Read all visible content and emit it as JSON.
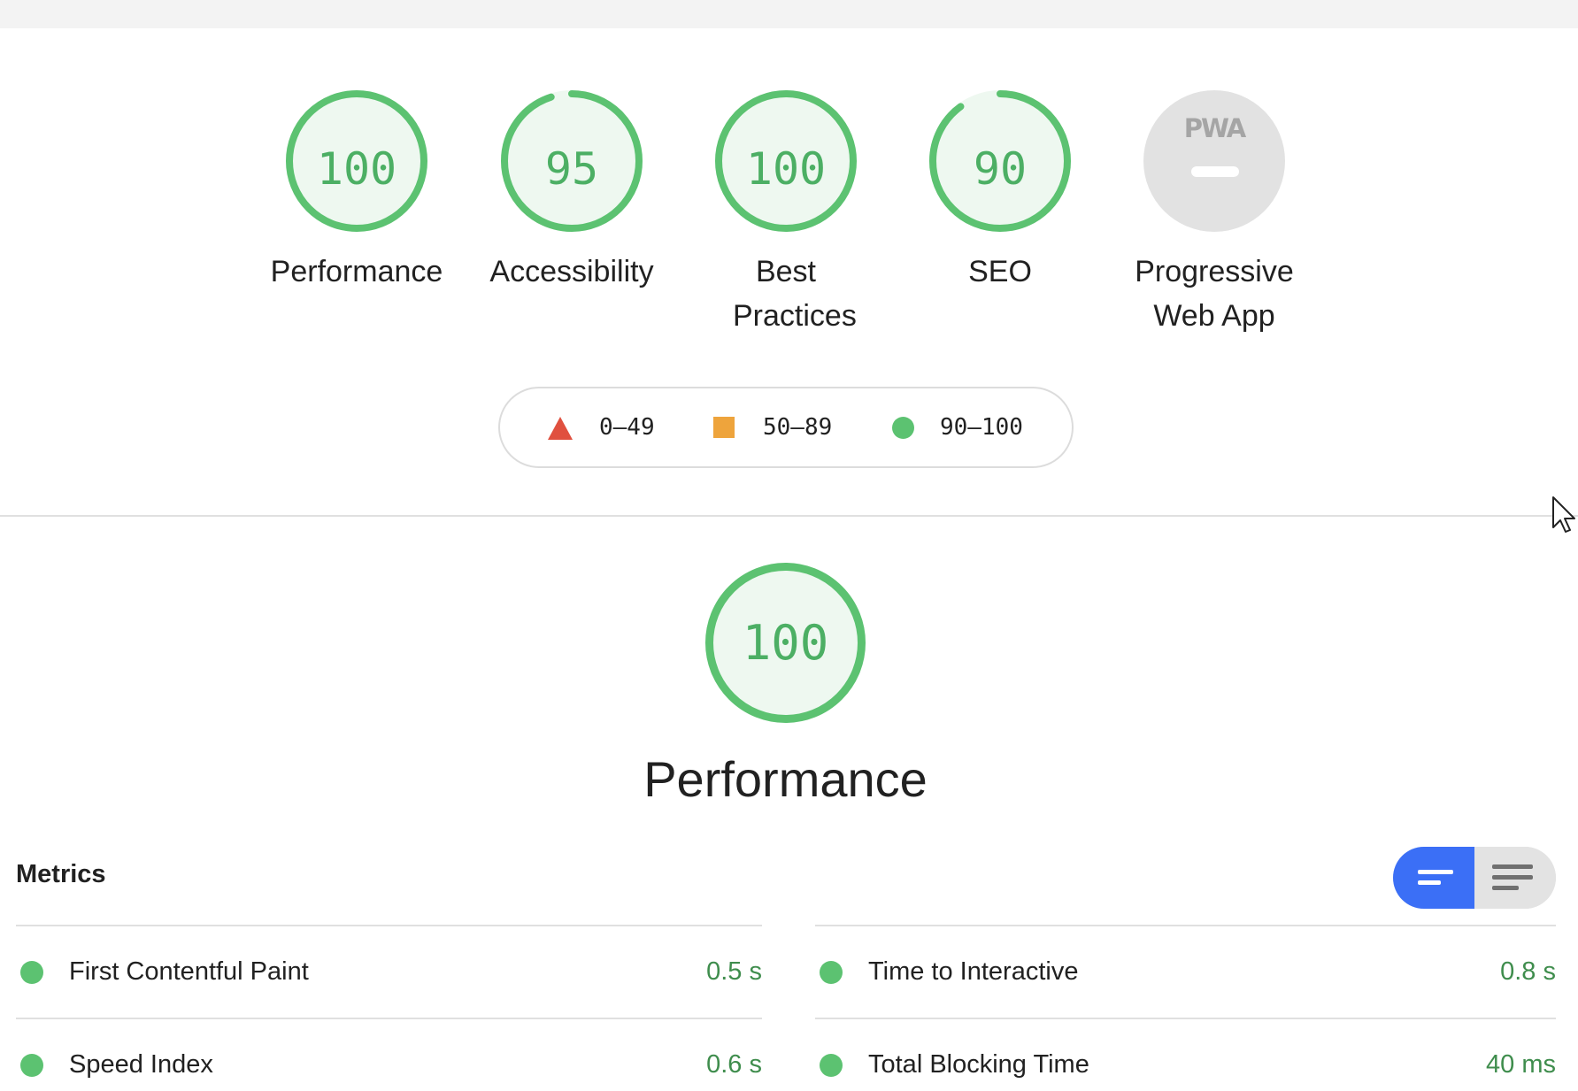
{
  "categories": [
    {
      "score": "100",
      "score_value": 100,
      "label": "Performance"
    },
    {
      "score": "95",
      "score_value": 95,
      "label": "Accessibility"
    },
    {
      "score": "100",
      "score_value": 100,
      "label": "Best Practices"
    },
    {
      "score": "90",
      "score_value": 90,
      "label": "SEO"
    }
  ],
  "pwa": {
    "badge_text": "PWA",
    "label": "Progressive Web App"
  },
  "legend": {
    "fail": "0–49",
    "average": "50–89",
    "pass": "90–100"
  },
  "section": {
    "score": "100",
    "title": "Performance"
  },
  "metrics": {
    "heading": "Metrics",
    "left": [
      {
        "label": "First Contentful Paint",
        "value": "0.5 s"
      },
      {
        "label": "Speed Index",
        "value": "0.6 s"
      }
    ],
    "right": [
      {
        "label": "Time to Interactive",
        "value": "0.8 s"
      },
      {
        "label": "Total Blocking Time",
        "value": "40 ms"
      }
    ]
  },
  "colors": {
    "pass": "#5cc271",
    "pass_text": "#4caf64",
    "average": "#eea43c",
    "fail": "#e0503f",
    "toggle_active": "#3b6ff6"
  }
}
